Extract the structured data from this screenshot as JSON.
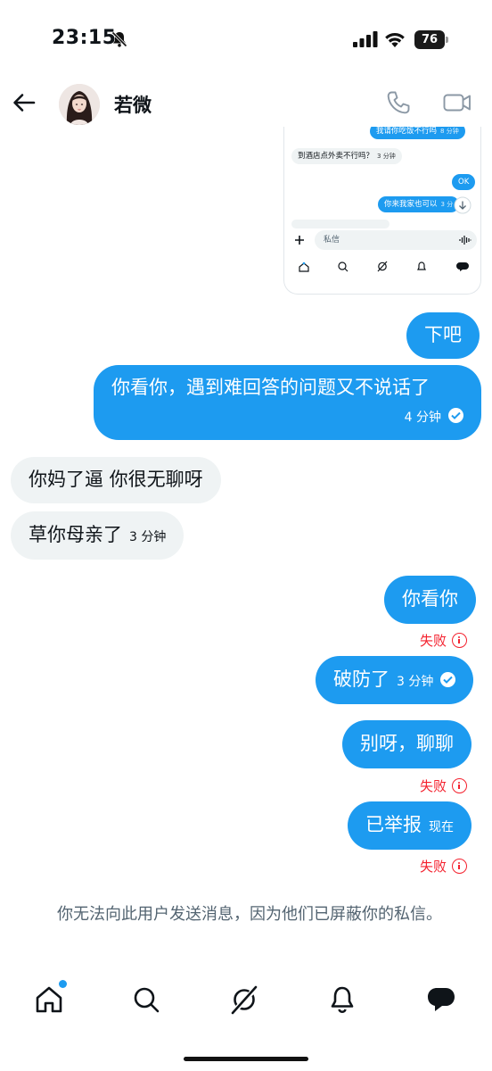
{
  "status_bar": {
    "time": "23:15",
    "battery": "76"
  },
  "header": {
    "contact_name": "若微"
  },
  "screenshot": {
    "msg_top": "我请你吃饭不行吗",
    "msg_top_time": "8 分钟",
    "msg_in": "到酒店点外卖不行吗？",
    "msg_in_time": "3 分钟",
    "msg_ok": "OK",
    "msg_last": "你来我家也可以",
    "msg_last_time": "3 分",
    "input_placeholder": "私信"
  },
  "messages": [
    {
      "dir": "out",
      "text": "下吧"
    },
    {
      "dir": "out",
      "text": "你看你，遇到难回答的问题又不说话了",
      "time": "4 分钟"
    },
    {
      "dir": "in",
      "text": "你妈了逼 你很无聊呀"
    },
    {
      "dir": "in",
      "text": "草你母亲了",
      "time": "3 分钟"
    },
    {
      "dir": "out",
      "text": "你看你",
      "status": "失败"
    },
    {
      "dir": "out",
      "text": "破防了",
      "time": "3 分钟"
    },
    {
      "dir": "out",
      "text": "别呀，聊聊",
      "status": "失败"
    },
    {
      "dir": "out",
      "text": "已举报",
      "time": "现在",
      "status": "失败"
    }
  ],
  "notice": "你无法向此用户发送消息，因为他们已屏蔽你的私信。",
  "colors": {
    "accent": "#1d9bf0",
    "error": "#f4212e",
    "incoming_bg": "#eff3f4",
    "muted": "#536471"
  },
  "icons": [
    "back-arrow-icon",
    "phone-icon",
    "video-icon",
    "home-icon",
    "search-icon",
    "grok-icon",
    "bell-icon",
    "messages-icon"
  ]
}
